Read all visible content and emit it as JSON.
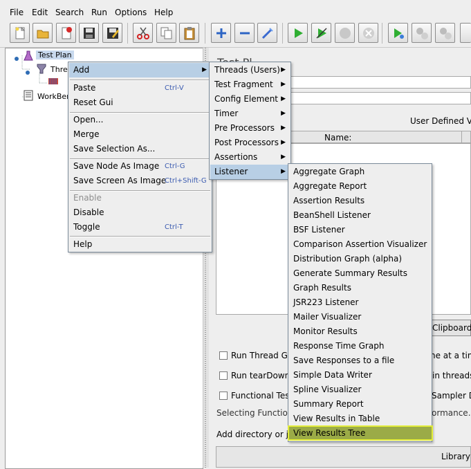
{
  "menubar": {
    "file": "File",
    "edit": "Edit",
    "search": "Search",
    "run": "Run",
    "options": "Options",
    "help": "Help"
  },
  "tree": {
    "test_plan": "Test Plan",
    "thread": "Threa",
    "workbench": "WorkBen"
  },
  "right_panel": {
    "title_fragment": "Test Pl",
    "user_defined": "User Defined Va",
    "name_col": "Name:",
    "clipboard": "Clipboard",
    "run_thread": "Run Thread Gr",
    "run_thread_tail": "ne at a tim",
    "run_teardown": "Run tearDown",
    "run_teardown_tail": "in threads",
    "functional": "Functional Tes",
    "functional_tail": "Sampler D",
    "selecting": "Selecting Functional",
    "selecting_tail": "ormance.",
    "add_dir": "Add directory or ja",
    "library": "Library"
  },
  "context_menu": {
    "add": "Add",
    "paste": "Paste",
    "paste_acc": "Ctrl-V",
    "reset_gui": "Reset Gui",
    "open": "Open...",
    "merge": "Merge",
    "save_selection": "Save Selection As...",
    "save_node_image": "Save Node As Image",
    "save_node_image_acc": "Ctrl-G",
    "save_screen_image": "Save Screen As Image",
    "save_screen_image_acc": "Ctrl+Shift-G",
    "enable": "Enable",
    "disable": "Disable",
    "toggle": "Toggle",
    "toggle_acc": "Ctrl-T",
    "help": "Help"
  },
  "add_menu": {
    "items": [
      "Threads (Users)",
      "Test Fragment",
      "Config Element",
      "Timer",
      "Pre Processors",
      "Post Processors",
      "Assertions",
      "Listener"
    ]
  },
  "listener_menu": {
    "items": [
      "Aggregate Graph",
      "Aggregate Report",
      "Assertion Results",
      "BeanShell Listener",
      "BSF Listener",
      "Comparison Assertion Visualizer",
      "Distribution Graph (alpha)",
      "Generate Summary Results",
      "Graph Results",
      "JSR223 Listener",
      "Mailer Visualizer",
      "Monitor Results",
      "Response Time Graph",
      "Save Responses to a file",
      "Simple Data Writer",
      "Spline Visualizer",
      "Summary Report",
      "View Results in Table",
      "View Results Tree"
    ]
  },
  "colors": {
    "menu_highlight": "#b8cfe5",
    "callout_border": "#e2ec3a",
    "callout_fill": "#9bab47"
  }
}
